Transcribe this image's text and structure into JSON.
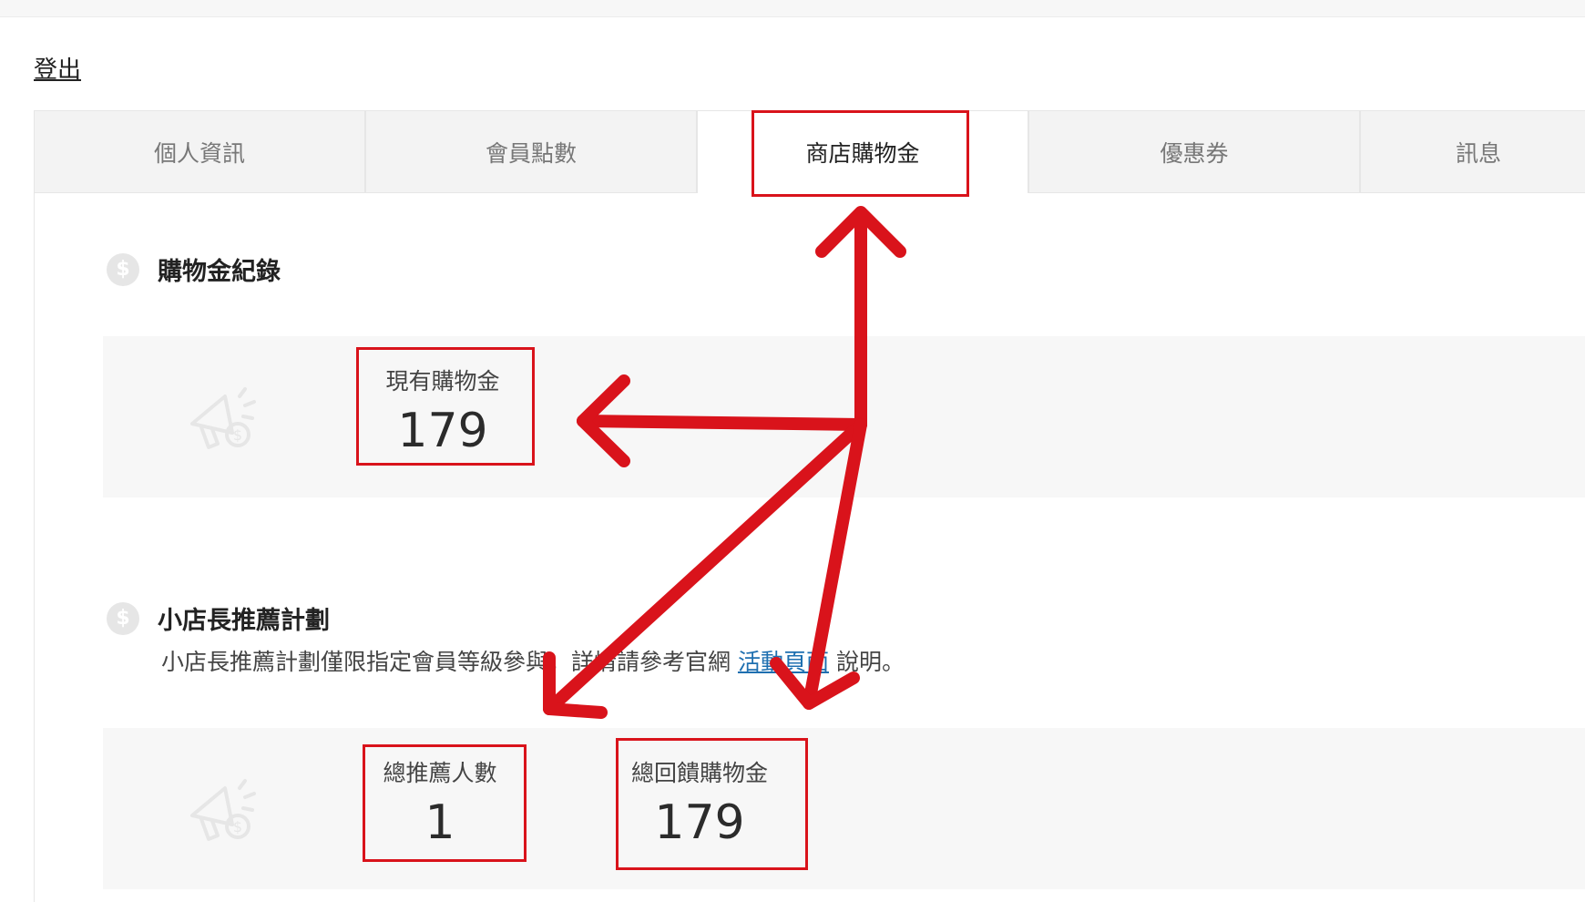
{
  "header": {
    "logout_label": "登出"
  },
  "tabs": [
    {
      "label": "個人資訊"
    },
    {
      "label": "會員點數"
    },
    {
      "label": "商店購物金"
    },
    {
      "label": "優惠券"
    },
    {
      "label": "訊息"
    }
  ],
  "active_tab_index": 2,
  "shopping_credit": {
    "title": "購物金紀錄",
    "current_label": "現有購物金",
    "current_value": "179"
  },
  "referral": {
    "title": "小店長推薦計劃",
    "description_before": "小店長推薦計劃僅限指定會員等級參與，詳情請參考官網",
    "link_text": "活動頁面",
    "description_after": "說明。",
    "total_referrals_label": "總推薦人數",
    "total_referrals_value": "1",
    "total_rebate_label": "總回饋購物金",
    "total_rebate_value": "179"
  },
  "icons": {
    "section_icon": "dollar-circle-icon",
    "panel_icon": "megaphone-dollar-icon"
  },
  "colors": {
    "annotation_red": "#d9131b",
    "link_blue": "#1e6fb0",
    "panel_bg": "#f7f7f7"
  }
}
